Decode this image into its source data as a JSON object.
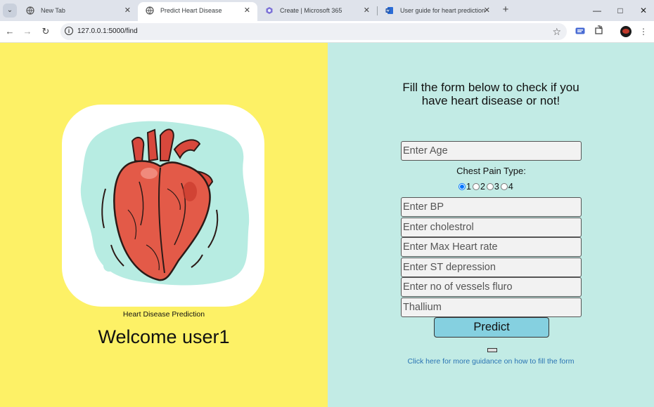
{
  "browser": {
    "tabs": [
      {
        "title": "New Tab",
        "active": false
      },
      {
        "title": "Predict Heart Disease",
        "active": true
      },
      {
        "title": "Create | Microsoft 365",
        "active": false
      },
      {
        "title": "User guide for heart prediction",
        "active": false
      }
    ],
    "url": "127.0.0.1:5000/find"
  },
  "left": {
    "caption": "Heart Disease Prediction",
    "welcome": "Welcome user1"
  },
  "form": {
    "title": "Fill the form below to check if you have heart disease or not!",
    "age_placeholder": "Enter Age",
    "chest_pain_label": "Chest Pain Type:",
    "chest_pain_options": [
      "1",
      "2",
      "3",
      "4"
    ],
    "chest_pain_selected": "1",
    "bp_placeholder": "Enter BP",
    "chol_placeholder": "Enter cholestrol",
    "max_hr_placeholder": "Enter Max Heart rate",
    "st_placeholder": "Enter ST depression",
    "vessels_placeholder": "Enter no of vessels fluro",
    "thal_placeholder": "Thallium",
    "predict_label": "Predict",
    "guide_link": "Click here for more guidance on how to fill the form"
  },
  "colors": {
    "left_bg": "#fdf166",
    "right_bg": "#c2ebe5",
    "button_bg": "#85d0e0",
    "link": "#2a74b3"
  }
}
